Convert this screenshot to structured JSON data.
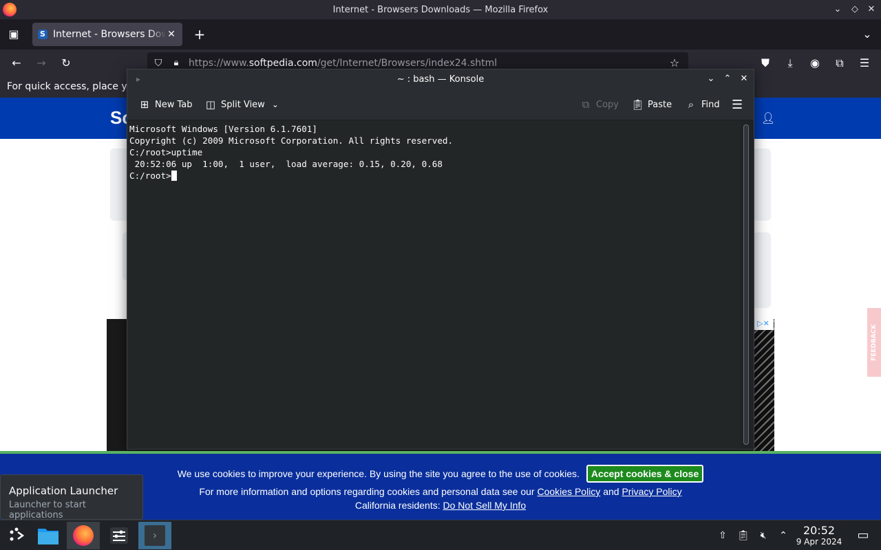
{
  "firefox": {
    "window_title": "Internet - Browsers Downloads — Mozilla Firefox",
    "tab_title": "Internet - Browsers Downloads",
    "tab_favicon": "S",
    "url_prefix": "https://www.",
    "url_domain": "softpedia.com",
    "url_path": "/get/Internet/Browsers/index24.shtml",
    "bookmarks_hint": "For quick access, place yo"
  },
  "site": {
    "logo": "Sc",
    "feedback": "FEEDBACK",
    "ad_marker": "▷✕"
  },
  "konsole": {
    "title": "~ : bash — Konsole",
    "new_tab": "New Tab",
    "split_view": "Split View",
    "copy": "Copy",
    "paste": "Paste",
    "find": "Find",
    "lines": [
      "Microsoft Windows [Version 6.1.7601]",
      "Copyright (c) 2009 Microsoft Corporation. All rights reserved.",
      "",
      "C:/root>uptime",
      " 20:52:06 up  1:00,  1 user,  load average: 0.15, 0.20, 0.68"
    ],
    "prompt": "C:/root>"
  },
  "cookie": {
    "line1": "We use cookies to improve your experience. By using the site you agree to the use of cookies.",
    "accept": "Accept cookies & close",
    "line2_prefix": "For more information and options regarding cookies and personal data see our",
    "cookies_policy": "Cookies Policy",
    "and": "and",
    "privacy_policy": "Privacy Policy",
    "line3_prefix": "California residents:",
    "do_not_sell": "Do Not Sell My Info"
  },
  "tooltip": {
    "title": "Application Launcher",
    "subtitle": "Launcher to start applications"
  },
  "taskbar": {
    "time": "20:52",
    "date": "9 Apr 2024"
  },
  "colors": {
    "site_header": "#003bb0",
    "cookie_bg": "#0a2f9c",
    "accept_green": "#1d8a1d"
  }
}
